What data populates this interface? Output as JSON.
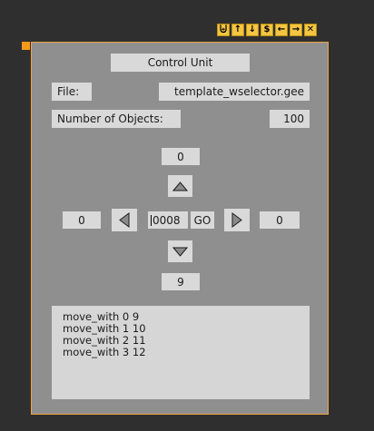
{
  "toolbar": {
    "buttons": [
      {
        "name": "merge-icon",
        "glyph": "⨄"
      },
      {
        "name": "arrow-up-icon",
        "glyph": "↑"
      },
      {
        "name": "arrow-down-icon",
        "glyph": "↓"
      },
      {
        "name": "dollar-icon",
        "glyph": "$"
      },
      {
        "name": "arrow-left-icon",
        "glyph": "←"
      },
      {
        "name": "arrow-right-icon",
        "glyph": "→"
      },
      {
        "name": "close-icon",
        "glyph": "✕"
      }
    ]
  },
  "panel": {
    "title": "Control Unit",
    "file_label": "File:",
    "file_value": "template_wselector.gee",
    "num_objects_label": "Number of Objects:",
    "num_objects_value": "100",
    "top_value": "0",
    "left_value": "0",
    "center_value": "0008",
    "go_label": "GO",
    "right_value": "0",
    "bottom_value": "9",
    "log": [
      "move_with 0 9",
      "move_with 1 10",
      "move_with 2 11",
      "move_with 3 12"
    ]
  },
  "colors": {
    "background": "#2f2f2f",
    "panel": "#8f8f8f",
    "panel_border": "#f0a441",
    "toolbar": "#f4c542",
    "field": "#d9d9d9"
  }
}
